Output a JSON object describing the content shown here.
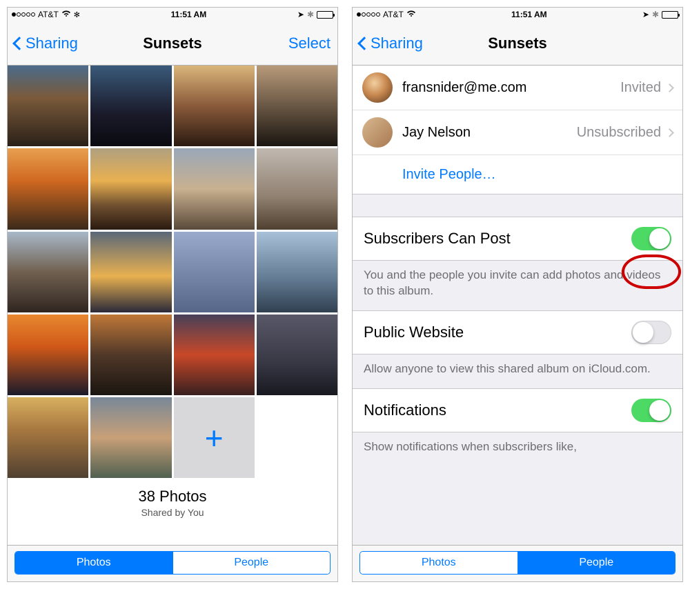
{
  "status": {
    "carrier": "AT&T",
    "time": "11:51 AM"
  },
  "left": {
    "back_label": "Sharing",
    "title": "Sunsets",
    "action_label": "Select",
    "photo_count": "38 Photos",
    "shared_by": "Shared by You",
    "add_glyph": "+",
    "tabs": {
      "photos": "Photos",
      "people": "People"
    }
  },
  "right": {
    "back_label": "Sharing",
    "title": "Sunsets",
    "people": [
      {
        "name": "fransnider@me.com",
        "status": "Invited"
      },
      {
        "name": "Jay Nelson",
        "status": "Unsubscribed"
      }
    ],
    "invite_label": "Invite People…",
    "settings": {
      "subscribers_label": "Subscribers Can Post",
      "subscribers_on": true,
      "subscribers_desc": "You and the people you invite can add photos and videos to this album.",
      "public_label": "Public Website",
      "public_on": false,
      "public_desc": "Allow anyone to view this shared album on iCloud.com.",
      "notifications_label": "Notifications",
      "notifications_on": true,
      "notifications_desc": "Show notifications when subscribers like,"
    },
    "tabs": {
      "photos": "Photos",
      "people": "People"
    }
  }
}
